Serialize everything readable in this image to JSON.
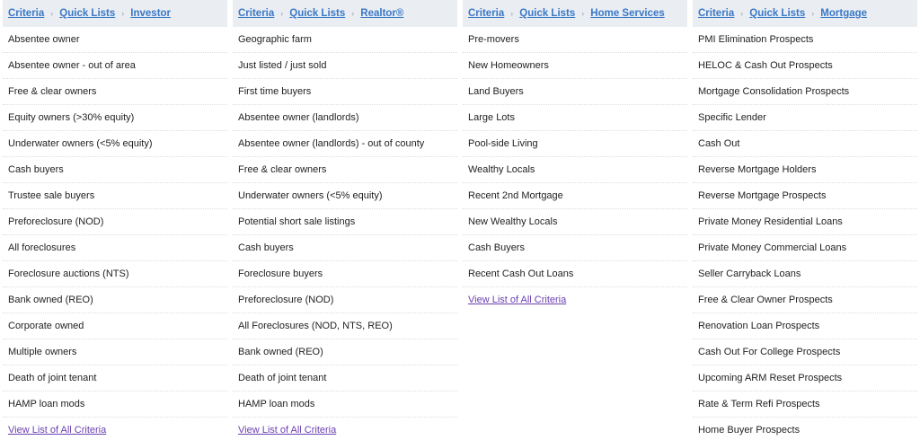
{
  "columns": [
    {
      "crumbs": [
        "Criteria",
        "Quick Lists",
        "Investor"
      ],
      "items": [
        "Absentee owner",
        "Absentee owner - out of area",
        "Free & clear owners",
        "Equity owners (>30% equity)",
        "Underwater owners (<5% equity)",
        "Cash buyers",
        "Trustee sale buyers",
        "Preforeclosure (NOD)",
        "All foreclosures",
        "Foreclosure auctions (NTS)",
        "Bank owned (REO)",
        "Corporate owned",
        "Multiple owners",
        "Death of joint tenant",
        "HAMP loan mods"
      ],
      "view_all": "View List of All Criteria"
    },
    {
      "crumbs": [
        "Criteria",
        "Quick Lists",
        "Realtor®"
      ],
      "items": [
        "Geographic farm",
        "Just listed / just sold",
        "First time buyers",
        "Absentee owner (landlords)",
        "Absentee owner (landlords) - out of county",
        "Free & clear owners",
        "Underwater owners (<5% equity)",
        "Potential short sale listings",
        "Cash buyers",
        "Foreclosure buyers",
        "Preforeclosure (NOD)",
        "All Foreclosures (NOD, NTS, REO)",
        "Bank owned (REO)",
        "Death of joint tenant",
        "HAMP loan mods"
      ],
      "view_all": "View List of All Criteria"
    },
    {
      "crumbs": [
        "Criteria",
        "Quick Lists",
        "Home Services"
      ],
      "items": [
        "Pre-movers",
        "New Homeowners",
        "Land Buyers",
        "Large Lots",
        "Pool-side Living",
        "Wealthy Locals",
        "Recent 2nd Mortgage",
        "New Wealthy Locals",
        "Cash Buyers",
        "Recent Cash Out Loans"
      ],
      "view_all": "View List of All Criteria"
    },
    {
      "crumbs": [
        "Criteria",
        "Quick Lists",
        "Mortgage"
      ],
      "items": [
        "PMI Elimination Prospects",
        "HELOC & Cash Out Prospects",
        "Mortgage Consolidation Prospects",
        "Specific Lender",
        "Cash Out",
        "Reverse Mortgage Holders",
        "Reverse Mortgage Prospects",
        "Private Money Residential Loans",
        "Private Money Commercial Loans",
        "Seller Carryback Loans",
        "Free & Clear Owner Prospects",
        "Renovation Loan Prospects",
        "Cash Out For College Prospects",
        "Upcoming ARM Reset Prospects",
        "Rate & Term Refi Prospects",
        "Home Buyer Prospects"
      ],
      "view_all": null
    }
  ]
}
